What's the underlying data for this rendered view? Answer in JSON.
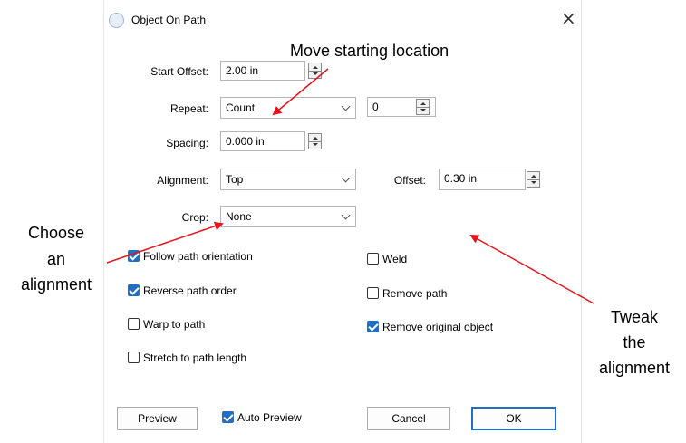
{
  "dialog": {
    "title": "Object On Path",
    "close_glyph": "×",
    "icon": "object-on-path-icon"
  },
  "form": {
    "start_offset": {
      "label": "Start Offset:",
      "value": "2.00 in"
    },
    "repeat": {
      "label": "Repeat:",
      "value": "Count",
      "count_value": "0"
    },
    "spacing": {
      "label": "Spacing:",
      "value": "0.000 in"
    },
    "alignment": {
      "label": "Alignment:",
      "value": "Top"
    },
    "offset": {
      "label": "Offset:",
      "value": "0.30 in"
    },
    "crop": {
      "label": "Crop:",
      "value": "None"
    }
  },
  "checkboxes": {
    "follow_path_orientation": {
      "label": "Follow path orientation",
      "checked": true
    },
    "reverse_path_order": {
      "label": "Reverse path order",
      "checked": true
    },
    "warp_to_path": {
      "label": "Warp to path",
      "checked": false
    },
    "stretch_to_path_length": {
      "label": "Stretch to path length",
      "checked": false
    },
    "weld": {
      "label": "Weld",
      "checked": false
    },
    "remove_path": {
      "label": "Remove path",
      "checked": false
    },
    "remove_original_object": {
      "label": "Remove original object",
      "checked": true
    },
    "auto_preview": {
      "label": "Auto Preview",
      "checked": true
    }
  },
  "buttons": {
    "preview": "Preview",
    "cancel": "Cancel",
    "ok": "OK"
  },
  "annotations": {
    "move_start": "Move starting location",
    "choose_l1": "Choose",
    "choose_l2": "an",
    "choose_l3": "alignment",
    "tweak_l1": "Tweak",
    "tweak_l2": "the",
    "tweak_l3": "alignment",
    "arrow_color": "#e8141c"
  },
  "colors": {
    "accent": "#1f6fc5"
  }
}
